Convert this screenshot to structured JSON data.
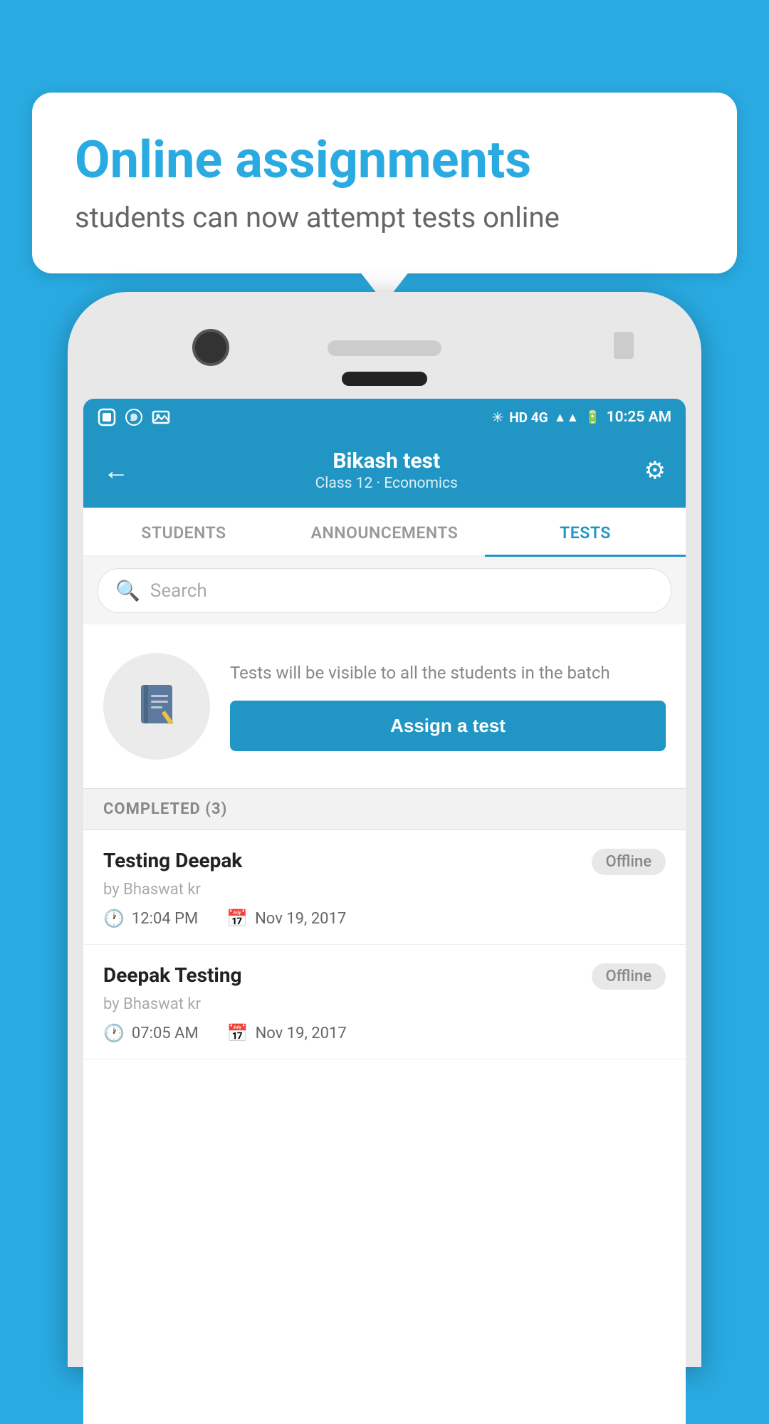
{
  "background_color": "#29abe2",
  "speech_bubble": {
    "title": "Online assignments",
    "subtitle": "students can now attempt tests online"
  },
  "status_bar": {
    "time": "10:25 AM",
    "network": "HD 4G"
  },
  "header": {
    "title": "Bikash test",
    "subtitle": "Class 12 · Economics",
    "back_label": "←",
    "settings_label": "⚙"
  },
  "tabs": [
    {
      "label": "STUDENTS",
      "active": false
    },
    {
      "label": "ANNOUNCEMENTS",
      "active": false
    },
    {
      "label": "TESTS",
      "active": true
    }
  ],
  "search": {
    "placeholder": "Search"
  },
  "assign_section": {
    "description": "Tests will be visible to all the students in the batch",
    "button_label": "Assign a test"
  },
  "completed_section": {
    "header": "COMPLETED (3)",
    "items": [
      {
        "name": "Testing Deepak",
        "author": "by Bhaswat kr",
        "time": "12:04 PM",
        "date": "Nov 19, 2017",
        "badge": "Offline"
      },
      {
        "name": "Deepak Testing",
        "author": "by Bhaswat kr",
        "time": "07:05 AM",
        "date": "Nov 19, 2017",
        "badge": "Offline"
      }
    ]
  }
}
